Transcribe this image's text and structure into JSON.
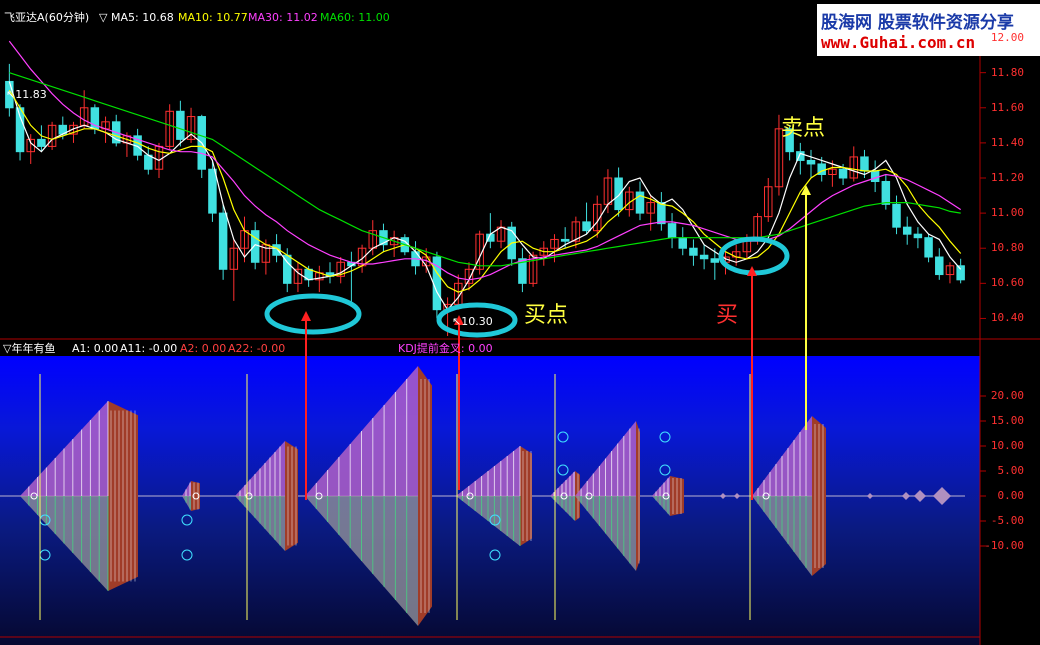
{
  "header": {
    "title": "飞亚达A(60分钟)",
    "ma_indicator": "▽",
    "ma5_label": "MA5:",
    "ma5_value": "10.68",
    "ma10_label": "MA10:",
    "ma10_value": "10.77",
    "ma30_label": "MA30:",
    "ma30_value": "11.02",
    "ma60_label": "MA60:",
    "ma60_value": "11.00"
  },
  "logo": {
    "brand_cn": "股海网",
    "slogan": "股票软件资源分享",
    "url": "www.Guhai.com.cn"
  },
  "indicator": {
    "name": "▽年年有鱼",
    "a1": "A1: 0.00",
    "a11": "A11: -0.00",
    "a2": "A2: 0.00",
    "a22": "A22: -0.00",
    "kdj": "KDJ提前金叉: 0.00"
  },
  "annotations": {
    "high_price": "11.83",
    "low_price": "10.30",
    "buy_point": "买点",
    "buy": "买",
    "sell_point": "卖点"
  },
  "colors": {
    "up": "#ff3030",
    "down": "#40e0e0",
    "ma5": "#ffffff",
    "ma10": "#ffff00",
    "ma30": "#ff40ff",
    "ma60": "#00e000",
    "ellipse": "#20c8d8",
    "arrow_red": "#ff2020",
    "arrow_yellow": "#ffff40"
  },
  "chart_data": [
    {
      "type": "candlestick",
      "title": "飞亚达A(60分钟)",
      "y_ticks": [
        "12.00",
        "11.80",
        "11.60",
        "11.40",
        "11.20",
        "11.00",
        "10.80",
        "10.60",
        "10.40"
      ],
      "ylim": [
        10.3,
        12.1
      ],
      "series": [
        {
          "name": "MA5",
          "values": [
            11.75,
            11.55,
            11.4,
            11.35,
            11.42,
            11.45,
            11.48,
            11.5,
            11.48,
            11.46,
            11.42,
            11.4,
            11.38,
            11.33,
            11.3,
            11.34,
            11.4,
            11.45,
            11.4,
            11.3,
            11.05,
            10.85,
            10.75,
            10.82,
            10.8,
            10.8,
            10.72,
            10.66,
            10.62,
            10.63,
            10.64,
            10.66,
            10.7,
            10.74,
            10.8,
            10.83,
            10.86,
            10.84,
            10.78,
            10.7,
            10.55,
            10.45,
            10.52,
            10.62,
            10.75,
            10.88,
            10.92,
            10.9,
            10.82,
            10.75,
            10.74,
            10.78,
            10.82,
            10.85,
            10.88,
            10.95,
            11.05,
            11.1,
            11.18,
            11.2,
            11.1,
            11.05,
            11.08,
            11.02,
            10.92,
            10.82,
            10.78,
            10.74,
            10.72,
            10.74,
            10.78,
            10.86,
            11.0,
            11.2,
            11.34,
            11.32,
            11.3,
            11.28,
            11.26,
            11.24,
            11.22,
            11.25,
            11.3,
            11.2,
            11.05,
            10.95,
            10.88,
            10.85,
            10.75,
            10.68
          ]
        },
        {
          "name": "MA10",
          "values": [
            11.7,
            11.6,
            11.5,
            11.44,
            11.42,
            11.44,
            11.46,
            11.48,
            11.48,
            11.46,
            11.44,
            11.42,
            11.4,
            11.37,
            11.35,
            11.34,
            11.36,
            11.38,
            11.38,
            11.35,
            11.2,
            11.02,
            10.9,
            10.86,
            10.82,
            10.8,
            10.76,
            10.72,
            10.68,
            10.66,
            10.64,
            10.65,
            10.67,
            10.7,
            10.74,
            10.78,
            10.8,
            10.82,
            10.8,
            10.76,
            10.66,
            10.58,
            10.55,
            10.57,
            10.62,
            10.7,
            10.78,
            10.83,
            10.84,
            10.8,
            10.78,
            10.78,
            10.8,
            10.82,
            10.84,
            10.88,
            10.95,
            11.0,
            11.06,
            11.1,
            11.08,
            11.05,
            11.04,
            11.0,
            10.95,
            10.88,
            10.83,
            10.78,
            10.75,
            10.74,
            10.75,
            10.8,
            10.88,
            11.0,
            11.12,
            11.2,
            11.24,
            11.26,
            11.26,
            11.25,
            11.24,
            11.24,
            11.25,
            11.22,
            11.15,
            11.05,
            10.98,
            10.92,
            10.84,
            10.77
          ]
        },
        {
          "name": "MA30",
          "values": [
            11.98,
            11.9,
            11.82,
            11.75,
            11.68,
            11.62,
            11.57,
            11.53,
            11.5,
            11.48,
            11.46,
            11.44,
            11.42,
            11.4,
            11.38,
            11.36,
            11.35,
            11.35,
            11.34,
            11.32,
            11.25,
            11.18,
            11.1,
            11.04,
            10.99,
            10.95,
            10.9,
            10.86,
            10.82,
            10.79,
            10.76,
            10.74,
            10.72,
            10.71,
            10.71,
            10.72,
            10.73,
            10.74,
            10.74,
            10.73,
            10.7,
            10.66,
            10.63,
            10.62,
            10.63,
            10.65,
            10.68,
            10.71,
            10.73,
            10.74,
            10.75,
            10.76,
            10.77,
            10.78,
            10.79,
            10.81,
            10.84,
            10.87,
            10.9,
            10.93,
            10.94,
            10.95,
            10.95,
            10.94,
            10.93,
            10.91,
            10.89,
            10.87,
            10.85,
            10.84,
            10.84,
            10.85,
            10.87,
            10.91,
            10.96,
            11.01,
            11.06,
            11.1,
            11.13,
            11.16,
            11.18,
            11.2,
            11.22,
            11.21,
            11.19,
            11.16,
            11.13,
            11.1,
            11.06,
            11.02
          ]
        },
        {
          "name": "MA60",
          "values": [
            11.8,
            11.78,
            11.76,
            11.74,
            11.72,
            11.7,
            11.68,
            11.66,
            11.64,
            11.62,
            11.6,
            11.58,
            11.56,
            11.54,
            11.52,
            11.5,
            11.48,
            11.46,
            11.44,
            11.42,
            11.38,
            11.34,
            11.3,
            11.26,
            11.22,
            11.18,
            11.14,
            11.1,
            11.06,
            11.02,
            10.99,
            10.96,
            10.93,
            10.9,
            10.88,
            10.86,
            10.84,
            10.82,
            10.8,
            10.78,
            10.76,
            10.74,
            10.72,
            10.71,
            10.7,
            10.7,
            10.7,
            10.71,
            10.72,
            10.73,
            10.74,
            10.75,
            10.76,
            10.77,
            10.78,
            10.79,
            10.8,
            10.81,
            10.82,
            10.83,
            10.84,
            10.85,
            10.86,
            10.86,
            10.86,
            10.86,
            10.86,
            10.86,
            10.86,
            10.86,
            10.86,
            10.87,
            10.88,
            10.9,
            10.92,
            10.94,
            10.96,
            10.98,
            11.0,
            11.02,
            11.04,
            11.05,
            11.06,
            11.06,
            11.06,
            11.05,
            11.04,
            11.03,
            11.01,
            11.0
          ]
        }
      ],
      "candles": [
        [
          11.75,
          11.85,
          11.55,
          11.6
        ],
        [
          11.6,
          11.62,
          11.3,
          11.35
        ],
        [
          11.35,
          11.45,
          11.28,
          11.42
        ],
        [
          11.42,
          11.5,
          11.35,
          11.38
        ],
        [
          11.38,
          11.52,
          11.36,
          11.5
        ],
        [
          11.5,
          11.55,
          11.42,
          11.45
        ],
        [
          11.45,
          11.52,
          11.4,
          11.5
        ],
        [
          11.5,
          11.7,
          11.48,
          11.6
        ],
        [
          11.6,
          11.62,
          11.45,
          11.48
        ],
        [
          11.48,
          11.55,
          11.4,
          11.52
        ],
        [
          11.52,
          11.56,
          11.38,
          11.4
        ],
        [
          11.4,
          11.46,
          11.32,
          11.44
        ],
        [
          11.44,
          11.48,
          11.3,
          11.33
        ],
        [
          11.33,
          11.38,
          11.22,
          11.25
        ],
        [
          11.25,
          11.4,
          11.2,
          11.38
        ],
        [
          11.38,
          11.62,
          11.36,
          11.58
        ],
        [
          11.58,
          11.64,
          11.38,
          11.42
        ],
        [
          11.42,
          11.6,
          11.4,
          11.55
        ],
        [
          11.55,
          11.56,
          11.2,
          11.25
        ],
        [
          11.25,
          11.3,
          10.95,
          11.0
        ],
        [
          11.0,
          11.05,
          10.62,
          10.68
        ],
        [
          10.68,
          10.85,
          10.5,
          10.8
        ],
        [
          10.8,
          10.98,
          10.72,
          10.9
        ],
        [
          10.9,
          10.95,
          10.68,
          10.72
        ],
        [
          10.72,
          10.85,
          10.65,
          10.82
        ],
        [
          10.82,
          10.88,
          10.72,
          10.76
        ],
        [
          10.76,
          10.8,
          10.55,
          10.6
        ],
        [
          10.6,
          10.72,
          10.55,
          10.68
        ],
        [
          10.68,
          10.7,
          10.58,
          10.62
        ],
        [
          10.62,
          10.7,
          10.55,
          10.66
        ],
        [
          10.66,
          10.72,
          10.6,
          10.64
        ],
        [
          10.64,
          10.75,
          10.6,
          10.72
        ],
        [
          10.72,
          10.78,
          10.48,
          10.7
        ],
        [
          10.7,
          10.82,
          10.66,
          10.8
        ],
        [
          10.8,
          10.96,
          10.76,
          10.9
        ],
        [
          10.9,
          10.94,
          10.78,
          10.82
        ],
        [
          10.82,
          10.9,
          10.75,
          10.86
        ],
        [
          10.86,
          10.88,
          10.76,
          10.78
        ],
        [
          10.78,
          10.84,
          10.65,
          10.7
        ],
        [
          10.7,
          10.8,
          10.66,
          10.75
        ],
        [
          10.75,
          10.78,
          10.4,
          10.45
        ],
        [
          10.45,
          10.52,
          10.3,
          10.48
        ],
        [
          10.48,
          10.65,
          10.45,
          10.6
        ],
        [
          10.6,
          10.72,
          10.56,
          10.68
        ],
        [
          10.68,
          10.9,
          10.65,
          10.88
        ],
        [
          10.88,
          11.0,
          10.8,
          10.84
        ],
        [
          10.84,
          10.96,
          10.8,
          10.92
        ],
        [
          10.92,
          10.95,
          10.7,
          10.74
        ],
        [
          10.74,
          10.8,
          10.55,
          10.6
        ],
        [
          10.6,
          10.78,
          10.58,
          10.76
        ],
        [
          10.76,
          10.84,
          10.7,
          10.8
        ],
        [
          10.8,
          10.88,
          10.72,
          10.85
        ],
        [
          10.85,
          10.92,
          10.8,
          10.84
        ],
        [
          10.84,
          10.98,
          10.8,
          10.95
        ],
        [
          10.95,
          11.06,
          10.88,
          10.9
        ],
        [
          10.9,
          11.1,
          10.86,
          11.05
        ],
        [
          11.05,
          11.25,
          11.0,
          11.2
        ],
        [
          11.2,
          11.26,
          10.98,
          11.02
        ],
        [
          11.02,
          11.15,
          10.98,
          11.12
        ],
        [
          11.12,
          11.18,
          10.96,
          11.0
        ],
        [
          11.0,
          11.1,
          10.9,
          11.06
        ],
        [
          11.06,
          11.12,
          10.9,
          10.94
        ],
        [
          10.94,
          11.0,
          10.8,
          10.86
        ],
        [
          10.86,
          10.92,
          10.76,
          10.8
        ],
        [
          10.8,
          10.85,
          10.7,
          10.76
        ],
        [
          10.76,
          10.82,
          10.68,
          10.74
        ],
        [
          10.74,
          10.8,
          10.62,
          10.72
        ],
        [
          10.72,
          10.78,
          10.65,
          10.75
        ],
        [
          10.75,
          10.82,
          10.7,
          10.78
        ],
        [
          10.78,
          10.88,
          10.74,
          10.85
        ],
        [
          10.85,
          11.0,
          10.82,
          10.98
        ],
        [
          10.98,
          11.2,
          10.95,
          11.15
        ],
        [
          11.15,
          11.56,
          11.1,
          11.48
        ],
        [
          11.48,
          11.5,
          11.3,
          11.35
        ],
        [
          11.35,
          11.4,
          11.22,
          11.3
        ],
        [
          11.3,
          11.36,
          11.2,
          11.28
        ],
        [
          11.28,
          11.32,
          11.18,
          11.22
        ],
        [
          11.22,
          11.3,
          11.15,
          11.25
        ],
        [
          11.25,
          11.28,
          11.16,
          11.2
        ],
        [
          11.2,
          11.38,
          11.18,
          11.32
        ],
        [
          11.32,
          11.36,
          11.2,
          11.24
        ],
        [
          11.24,
          11.3,
          11.12,
          11.18
        ],
        [
          11.18,
          11.22,
          11.02,
          11.05
        ],
        [
          11.05,
          11.1,
          10.88,
          10.92
        ],
        [
          10.92,
          10.98,
          10.82,
          10.88
        ],
        [
          10.88,
          10.92,
          10.8,
          10.86
        ],
        [
          10.86,
          10.88,
          10.72,
          10.75
        ],
        [
          10.75,
          10.8,
          10.62,
          10.65
        ],
        [
          10.65,
          10.72,
          10.6,
          10.7
        ],
        [
          10.7,
          10.74,
          10.6,
          10.62
        ]
      ]
    },
    {
      "type": "area",
      "title": "▽年年有鱼",
      "y_ticks": [
        "20.00",
        "15.00",
        "10.00",
        "5.00",
        "0.00",
        "-5.00",
        "-10.00"
      ],
      "ylim": [
        -27,
        27
      ],
      "series": [
        {
          "name": "A1",
          "values": [
            0,
            19,
            18,
            0,
            3,
            0,
            11,
            9,
            0,
            26,
            25,
            0,
            0,
            0,
            0,
            10,
            0,
            8,
            0,
            15,
            6,
            0,
            3,
            0,
            0,
            16,
            15,
            0,
            0,
            0,
            0,
            0,
            0,
            0,
            0,
            0
          ]
        },
        {
          "name": "A11",
          "values": [
            0,
            -19,
            -18,
            0,
            -3,
            0,
            -11,
            -9,
            0,
            -26,
            -25,
            0,
            0,
            0,
            0,
            -10,
            0,
            -8,
            0,
            -15,
            -6,
            0,
            -3,
            0,
            0,
            -16,
            -15,
            0,
            0,
            0,
            0,
            0,
            0,
            0,
            0,
            0
          ]
        }
      ]
    }
  ]
}
